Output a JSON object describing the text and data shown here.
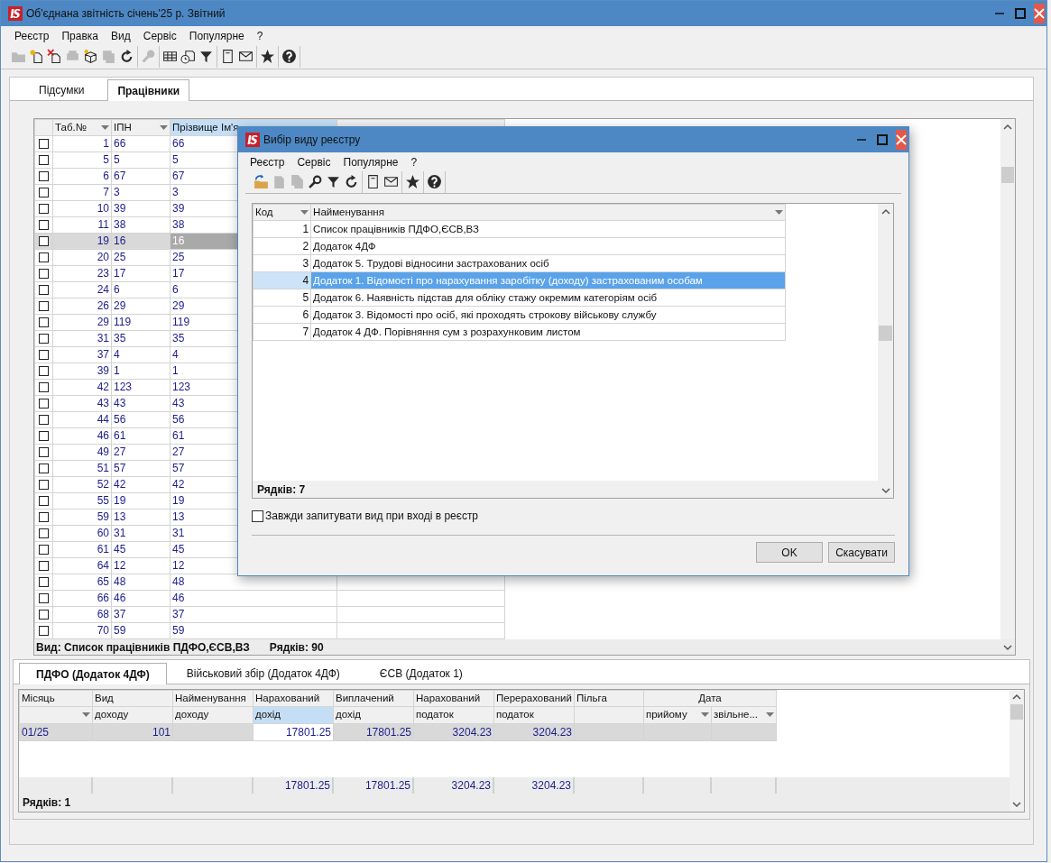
{
  "window": {
    "title": "Об'єднана звітність січень'25 р. Звітний"
  },
  "menu": [
    "Реєстр",
    "Правка",
    "Вид",
    "Сервіс",
    "Популярне",
    "?"
  ],
  "toolbar": [
    [
      {
        "disabled": true
      },
      {
        "disabled": false
      },
      {
        "disabled": false
      },
      {
        "disabled": true
      },
      {
        "disabled": false
      },
      {
        "disabled": true
      },
      {
        "disabled": false
      }
    ],
    [
      {
        "disabled": true
      }
    ],
    [
      {
        "disabled": false
      },
      {
        "disabled": false
      },
      {
        "disabled": false
      }
    ],
    [
      {
        "disabled": false
      },
      {
        "disabled": false
      }
    ],
    [
      {
        "disabled": false
      }
    ],
    [
      {
        "disabled": false
      }
    ]
  ],
  "tabs": [
    {
      "label": "Підсумки",
      "selected": false
    },
    {
      "label": "Працівники",
      "selected": true
    }
  ],
  "employees": {
    "columns": [
      {
        "title": "Таб.№",
        "dropdown": true,
        "selected": false
      },
      {
        "title": "ІПН",
        "dropdown": true,
        "selected": false
      },
      {
        "title": "Прізвище Ім'я",
        "selected": true
      },
      {
        "selected": false
      }
    ],
    "rows": [
      {
        "checked": false,
        "selected": false,
        "cells": [
          "1",
          "66",
          "66"
        ]
      },
      {
        "checked": false,
        "selected": false,
        "cells": [
          "5",
          "5",
          "5"
        ]
      },
      {
        "checked": false,
        "selected": false,
        "cells": [
          "6",
          "67",
          "67"
        ]
      },
      {
        "checked": false,
        "selected": false,
        "cells": [
          "7",
          "3",
          "3"
        ]
      },
      {
        "checked": false,
        "selected": false,
        "cells": [
          "10",
          "39",
          "39"
        ]
      },
      {
        "checked": false,
        "selected": false,
        "cells": [
          "11",
          "38",
          "38"
        ]
      },
      {
        "checked": false,
        "selected": true,
        "cells": [
          "19",
          "16",
          "16"
        ]
      },
      {
        "checked": false,
        "selected": false,
        "cells": [
          "20",
          "25",
          "25"
        ]
      },
      {
        "checked": false,
        "selected": false,
        "cells": [
          "23",
          "17",
          "17"
        ]
      },
      {
        "checked": false,
        "selected": false,
        "cells": [
          "24",
          "6",
          "6"
        ]
      },
      {
        "checked": false,
        "selected": false,
        "cells": [
          "26",
          "29",
          "29"
        ]
      },
      {
        "checked": false,
        "selected": false,
        "cells": [
          "29",
          "119",
          "119"
        ]
      },
      {
        "checked": false,
        "selected": false,
        "cells": [
          "31",
          "35",
          "35"
        ]
      },
      {
        "checked": false,
        "selected": false,
        "cells": [
          "37",
          "4",
          "4"
        ]
      },
      {
        "checked": false,
        "selected": false,
        "cells": [
          "39",
          "1",
          "1"
        ]
      },
      {
        "checked": false,
        "selected": false,
        "cells": [
          "42",
          "123",
          "123"
        ]
      },
      {
        "checked": false,
        "selected": false,
        "cells": [
          "43",
          "43",
          "43"
        ]
      },
      {
        "checked": false,
        "selected": false,
        "cells": [
          "44",
          "56",
          "56"
        ]
      },
      {
        "checked": false,
        "selected": false,
        "cells": [
          "46",
          "61",
          "61"
        ]
      },
      {
        "checked": false,
        "selected": false,
        "cells": [
          "49",
          "27",
          "27"
        ]
      },
      {
        "checked": false,
        "selected": false,
        "cells": [
          "51",
          "57",
          "57"
        ]
      },
      {
        "checked": false,
        "selected": false,
        "cells": [
          "52",
          "42",
          "42"
        ]
      },
      {
        "checked": false,
        "selected": false,
        "cells": [
          "55",
          "19",
          "19"
        ]
      },
      {
        "checked": false,
        "selected": false,
        "cells": [
          "59",
          "13",
          "13"
        ]
      },
      {
        "checked": false,
        "selected": false,
        "cells": [
          "60",
          "31",
          "31"
        ]
      },
      {
        "checked": false,
        "selected": false,
        "cells": [
          "61",
          "45",
          "45"
        ]
      },
      {
        "checked": false,
        "selected": false,
        "cells": [
          "64",
          "12",
          "12"
        ]
      },
      {
        "checked": false,
        "selected": false,
        "cells": [
          "65",
          "48",
          "48"
        ]
      },
      {
        "checked": false,
        "selected": false,
        "cells": [
          "66",
          "46",
          "46"
        ]
      },
      {
        "checked": false,
        "selected": false,
        "cells": [
          "68",
          "37",
          "37"
        ]
      },
      {
        "checked": false,
        "selected": false,
        "cells": [
          "70",
          "59",
          "59"
        ]
      }
    ],
    "view": "Вид: Список працівників ПДФО,ЄСВ,ВЗ",
    "count": "Рядків: 90"
  },
  "details": {
    "tabs": [
      {
        "label": "ПДФО (Додаток 4ДФ)",
        "selected": true
      },
      {
        "label": "Військовий збір (Додаток 4ДФ)",
        "selected": false
      },
      {
        "label": "ЄСВ (Додаток 1)",
        "selected": false
      }
    ],
    "group_header": "Дата",
    "columns": [
      {
        "title": "Місяць",
        "dropdown": true,
        "selected": false
      },
      {
        "title": "Вид",
        "subtitle": "доходу",
        "selected": false
      },
      {
        "title": "Найменування",
        "subtitle": "доходу",
        "selected": false
      },
      {
        "title": "Нарахований",
        "subtitle": "дохід",
        "selected": true,
        "total": "17801.25"
      },
      {
        "title": "Виплачений",
        "subtitle": "дохід",
        "selected": false,
        "total": "17801.25"
      },
      {
        "title": "Нарахований",
        "subtitle": "податок",
        "selected": false,
        "total": "3204.23"
      },
      {
        "title": "Перерахований",
        "subtitle": "податок",
        "selected": false,
        "total": "3204.23"
      },
      {
        "title": "Пільга",
        "selected": false
      },
      {
        "subtitle": "прийому",
        "dropdown": true,
        "selected": false
      },
      {
        "subtitle": "звільне...",
        "dropdown": true,
        "selected": false
      }
    ],
    "rows": [
      {
        "selected": true,
        "cells": [
          "01/25",
          "101",
          null,
          "17801.25",
          "17801.25",
          "3204.23",
          "3204.23",
          null,
          null,
          null
        ]
      }
    ],
    "count": "Рядків: 1"
  },
  "dialog": {
    "title": "Вибір виду реєстру",
    "menu": [
      "Реєстр",
      "Сервіс",
      "Популярне",
      "?"
    ],
    "toolbar": [
      [
        {
          "disabled": false
        },
        {
          "disabled": true
        },
        {
          "disabled": true
        },
        {
          "disabled": false
        },
        {
          "disabled": false
        },
        {
          "disabled": false
        }
      ],
      [
        {
          "disabled": false
        },
        {
          "disabled": false
        }
      ],
      [
        {
          "disabled": false
        }
      ],
      [
        {
          "disabled": false
        }
      ]
    ],
    "columns": [
      {
        "title": "Код",
        "dropdown": true
      },
      {
        "title": "Найменування",
        "dropdown": true
      }
    ],
    "rows": [
      {
        "code": "1",
        "name": "Список працівників ПДФО,ЄСВ,ВЗ",
        "selected": false
      },
      {
        "code": "2",
        "name": "Додаток 4ДФ",
        "selected": false
      },
      {
        "code": "3",
        "name": "Додаток 5. Трудові  відносини застрахованих осіб",
        "selected": false
      },
      {
        "code": "4",
        "name": "Додаток 1. Відомості  про  нарахування заробітку (доходу) застрахованим особам",
        "selected": true
      },
      {
        "code": "5",
        "name": "Додаток 6. Наявність підстав для обліку стажу окремим категоріям осіб",
        "selected": false
      },
      {
        "code": "6",
        "name": "Додаток 3. Відомості про осіб, які проходять строкову військову службу",
        "selected": false
      },
      {
        "code": "7",
        "name": "Додаток 4 ДФ. Порівняння сум з розрахунковим листом",
        "selected": false
      }
    ],
    "count": "Рядків: 7",
    "always_ask": {
      "label": "Завжди запитувати вид при вході в реєстр",
      "checked": false
    },
    "buttons": [
      "OK",
      "Скасувати"
    ]
  }
}
